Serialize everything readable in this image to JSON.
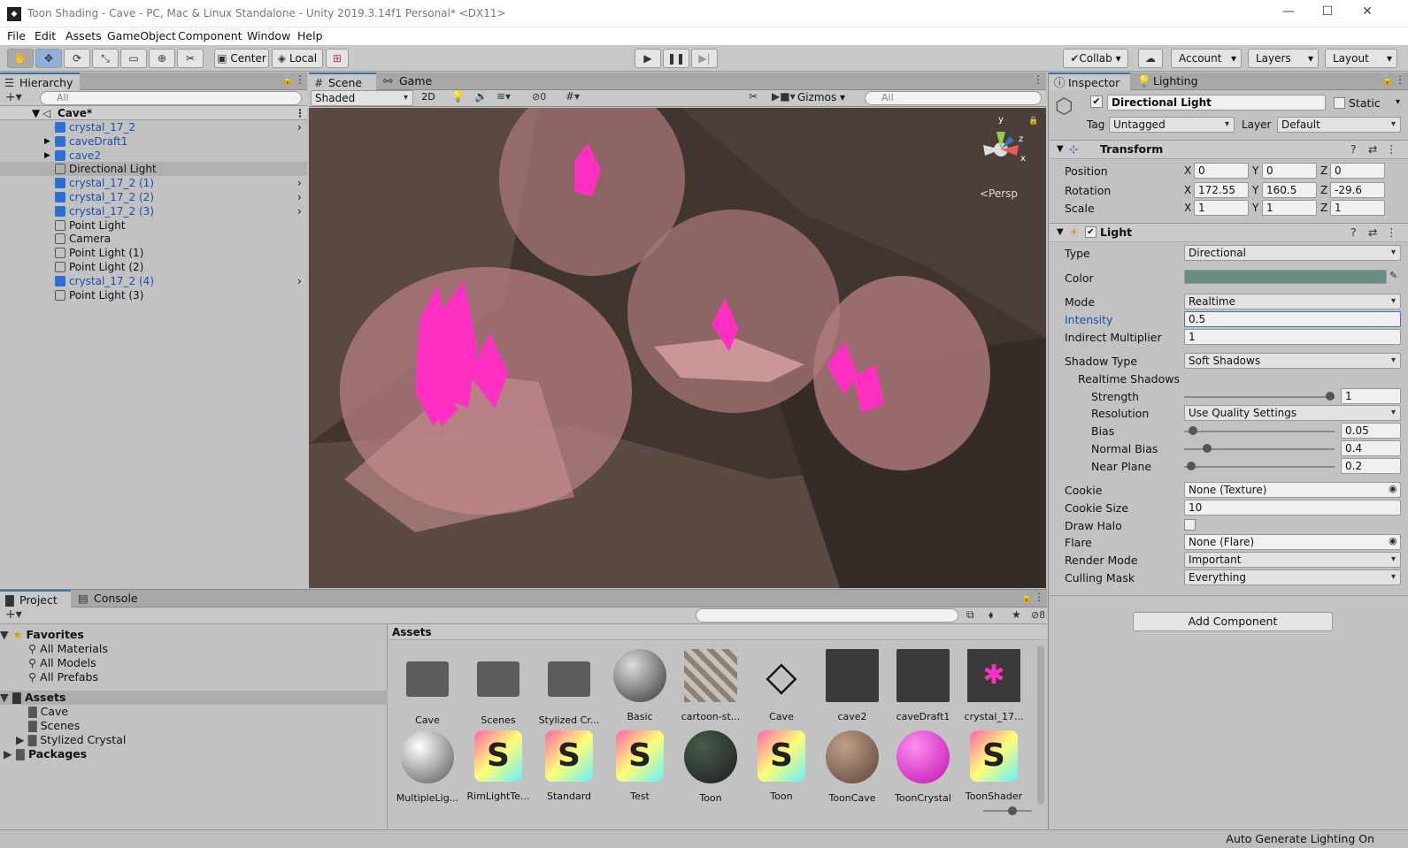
{
  "window": {
    "title": "Toon Shading - Cave - PC, Mac & Linux Standalone - Unity 2019.3.14f1 Personal* <DX11>"
  },
  "menu": [
    "File",
    "Edit",
    "Assets",
    "GameObject",
    "Component",
    "Window",
    "Help"
  ],
  "toolbar": {
    "center_label": "Center",
    "local_label": "Local",
    "collab_label": "Collab",
    "account_label": "Account",
    "layers_label": "Layers",
    "layout_label": "Layout"
  },
  "hierarchy": {
    "tab": "Hierarchy",
    "search_placeholder": "All",
    "scene_name": "Cave*",
    "items": [
      {
        "label": "crystal_17_2",
        "prefab": true
      },
      {
        "label": "caveDraft1",
        "prefab": true
      },
      {
        "label": "cave2",
        "prefab": true
      },
      {
        "label": "Directional Light",
        "prefab": false
      },
      {
        "label": "crystal_17_2 (1)",
        "prefab": true
      },
      {
        "label": "crystal_17_2 (2)",
        "prefab": true
      },
      {
        "label": "crystal_17_2 (3)",
        "prefab": true
      },
      {
        "label": "Point Light",
        "prefab": false
      },
      {
        "label": "Camera",
        "prefab": false
      },
      {
        "label": "Point Light (1)",
        "prefab": false
      },
      {
        "label": "Point Light (2)",
        "prefab": false
      },
      {
        "label": "crystal_17_2 (4)",
        "prefab": true
      },
      {
        "label": "Point Light (3)",
        "prefab": false
      }
    ]
  },
  "scene": {
    "tab_scene": "Scene",
    "tab_game": "Game",
    "shading_mode": "Shaded",
    "mode_2d": "2D",
    "hidden_count": "0",
    "gizmos_label": "Gizmos",
    "search_placeholder": "All",
    "persp_label": "<Persp",
    "axis_y": "y",
    "axis_z": "z",
    "axis_x": "x"
  },
  "inspector": {
    "tab_inspector": "Inspector",
    "tab_lighting": "Lighting",
    "object_name": "Directional Light",
    "static_label": "Static",
    "tag_label": "Tag",
    "tag_value": "Untagged",
    "layer_label": "Layer",
    "layer_value": "Default",
    "transform": {
      "title": "Transform",
      "position_label": "Position",
      "position": {
        "x": "0",
        "y": "0",
        "z": "0"
      },
      "rotation_label": "Rotation",
      "rotation": {
        "x": "172.55",
        "y": "160.5",
        "z": "-29.6"
      },
      "scale_label": "Scale",
      "scale": {
        "x": "1",
        "y": "1",
        "z": "1"
      }
    },
    "light": {
      "title": "Light",
      "type_label": "Type",
      "type": "Directional",
      "color_label": "Color",
      "color": "#6a8c86",
      "mode_label": "Mode",
      "mode": "Realtime",
      "intensity_label": "Intensity",
      "intensity": "0.5",
      "indirect_label": "Indirect Multiplier",
      "indirect": "1",
      "shadow_type_label": "Shadow Type",
      "shadow_type": "Soft Shadows",
      "realtime_shadows_label": "Realtime Shadows",
      "strength_label": "Strength",
      "strength": "1",
      "strength_frac": 1.0,
      "resolution_label": "Resolution",
      "resolution": "Use Quality Settings",
      "bias_label": "Bias",
      "bias": "0.05",
      "bias_frac": 0.03,
      "normal_bias_label": "Normal Bias",
      "normal_bias": "0.4",
      "normal_bias_frac": 0.13,
      "near_plane_label": "Near Plane",
      "near_plane": "0.2",
      "near_plane_frac": 0.02,
      "cookie_label": "Cookie",
      "cookie": "None (Texture)",
      "cookie_size_label": "Cookie Size",
      "cookie_size": "10",
      "draw_halo_label": "Draw Halo",
      "flare_label": "Flare",
      "flare": "None (Flare)",
      "render_mode_label": "Render Mode",
      "render_mode": "Important",
      "culling_mask_label": "Culling Mask",
      "culling_mask": "Everything"
    },
    "add_component": "Add Component"
  },
  "project": {
    "tab_project": "Project",
    "tab_console": "Console",
    "hidden_count": "8",
    "favorites_label": "Favorites",
    "favorites": [
      "All Materials",
      "All Models",
      "All Prefabs"
    ],
    "assets_label": "Assets",
    "asset_folders": [
      "Cave",
      "Scenes",
      "Stylized Crystal"
    ],
    "packages_label": "Packages",
    "breadcrumb": "Assets",
    "assets_row1": [
      {
        "label": "Cave",
        "kind": "folder"
      },
      {
        "label": "Scenes",
        "kind": "folder"
      },
      {
        "label": "Stylized Cr...",
        "kind": "folder"
      },
      {
        "label": "Basic",
        "kind": "material-grey"
      },
      {
        "label": "cartoon-st...",
        "kind": "texture"
      },
      {
        "label": "Cave",
        "kind": "unity-scene"
      },
      {
        "label": "cave2",
        "kind": "model"
      },
      {
        "label": "caveDraft1",
        "kind": "model"
      },
      {
        "label": "crystal_17...",
        "kind": "crystal"
      }
    ],
    "assets_row2": [
      {
        "label": "MultipleLig...",
        "kind": "material-white"
      },
      {
        "label": "RimLightTe...",
        "kind": "shader"
      },
      {
        "label": "Standard",
        "kind": "shader"
      },
      {
        "label": "Test",
        "kind": "shader"
      },
      {
        "label": "Toon",
        "kind": "material-dark"
      },
      {
        "label": "Toon",
        "kind": "shader"
      },
      {
        "label": "ToonCave",
        "kind": "material-brown"
      },
      {
        "label": "ToonCrystal",
        "kind": "material-pink"
      },
      {
        "label": "ToonShader",
        "kind": "shader"
      }
    ]
  },
  "status": {
    "text": "Auto Generate Lighting On"
  }
}
